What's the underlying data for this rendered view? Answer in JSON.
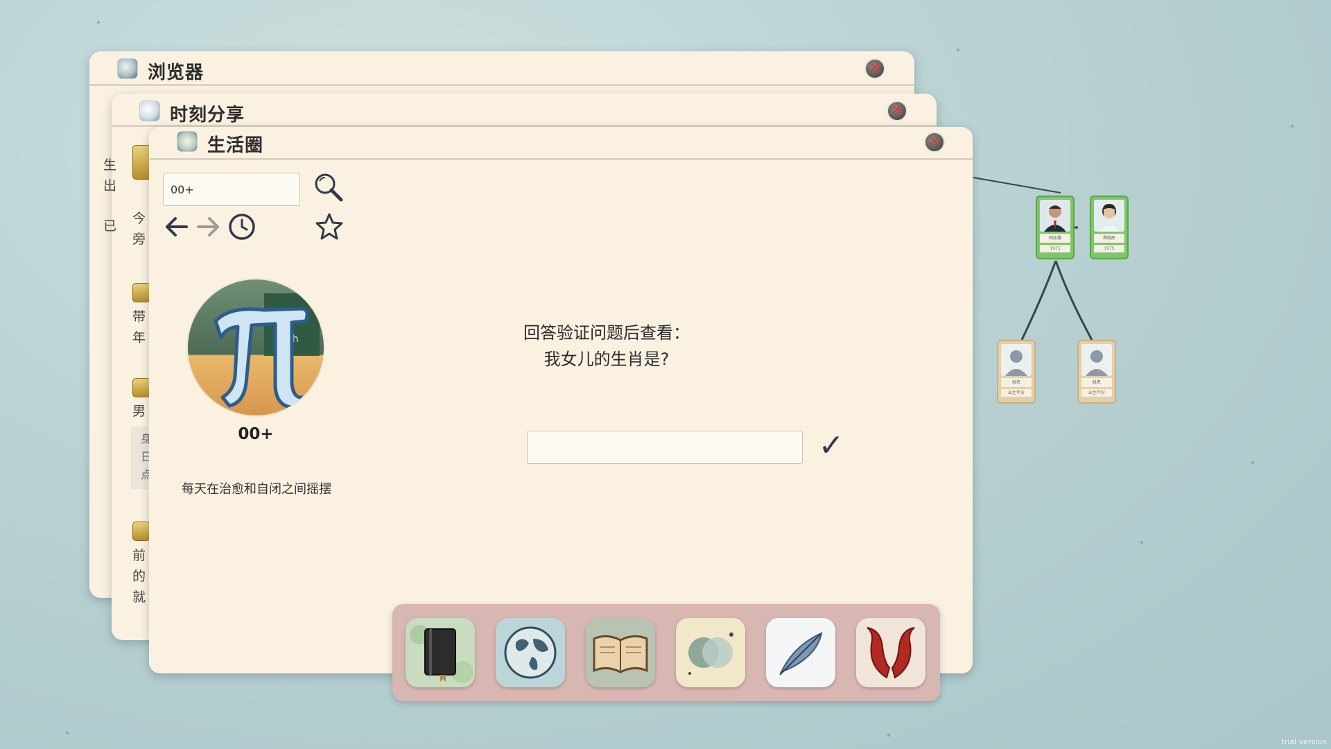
{
  "windows": {
    "browser": {
      "title": "浏览器",
      "close": "✕"
    },
    "moments": {
      "title": "时刻分享",
      "close": "✕",
      "peek_lines": [
        "生",
        "出",
        "已",
        "今",
        "旁",
        "带",
        "年",
        "男",
        "身",
        "日",
        "点",
        "前",
        "的",
        "就"
      ]
    },
    "life": {
      "title": "生活圈",
      "close": "✕",
      "search_value": "00+",
      "profile": {
        "name": "00+",
        "bio": "每天在治愈和自闭之间摇摆"
      },
      "verification": {
        "prompt_line1": "回答验证问题后查看：",
        "prompt_line2": "我女儿的生肖是?",
        "answer_value": "",
        "submit_glyph": "✓"
      }
    }
  },
  "toolbar_icons": [
    "search-icon",
    "back-arrow-icon",
    "forward-arrow-icon",
    "history-clock-icon",
    "favorite-star-icon"
  ],
  "dock": {
    "items": [
      {
        "name": "notebook-app-icon",
        "bg": "#c9dcc0"
      },
      {
        "name": "browser-globe-app-icon",
        "bg": "#bcd5d8"
      },
      {
        "name": "open-book-app-icon",
        "bg": "#b9c3b4"
      },
      {
        "name": "life-circle-app-icon",
        "bg": "#f0e8c8"
      },
      {
        "name": "feather-share-app-icon",
        "bg": "#f3f5f7"
      },
      {
        "name": "horns-app-icon",
        "bg": "#f1e4d8"
      }
    ]
  },
  "family_tree": {
    "parents": [
      {
        "name": "林弘德",
        "year": "1975"
      },
      {
        "name": "郑晓彤",
        "year": "1975"
      }
    ],
    "children": [
      {
        "name": "姓名",
        "year": "出生年份"
      },
      {
        "name": "姓名",
        "year": "出生年份"
      }
    ]
  },
  "watermark": "trial version"
}
